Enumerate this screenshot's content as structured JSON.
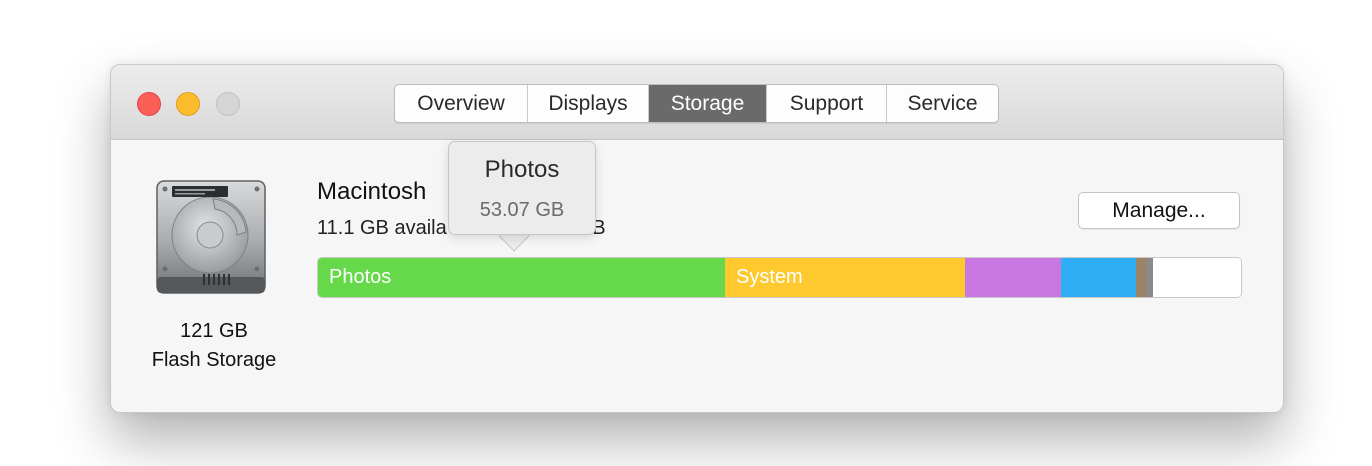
{
  "window": {
    "tabs": [
      {
        "label": "Overview",
        "active": false
      },
      {
        "label": "Displays",
        "active": false
      },
      {
        "label": "Storage",
        "active": true
      },
      {
        "label": "Support",
        "active": false
      },
      {
        "label": "Service",
        "active": false
      }
    ]
  },
  "disk": {
    "icon": "hard-drive-icon",
    "capacity": "121 GB",
    "type": "Flash Storage",
    "name": "Macintosh",
    "available_text": "11.1 GB availa",
    "available_text_tail": "GB"
  },
  "manage_button": {
    "label": "Manage..."
  },
  "tooltip": {
    "title": "Photos",
    "value": "53.07 GB"
  },
  "storage_bar": {
    "segments": [
      {
        "label": "Photos",
        "color": "#66d94a",
        "fraction": 0.441
      },
      {
        "label": "System",
        "color": "#fdc92f",
        "fraction": 0.26
      },
      {
        "label": "",
        "color": "#c878e0",
        "fraction": 0.104
      },
      {
        "label": "",
        "color": "#2eaef5",
        "fraction": 0.081
      },
      {
        "label": "",
        "color": "#9b8466",
        "fraction": 0.011
      },
      {
        "label": "",
        "color": "#8a8a8a",
        "fraction": 0.008
      },
      {
        "label": "",
        "color": "#ffffff",
        "fraction": 0.095
      }
    ]
  }
}
